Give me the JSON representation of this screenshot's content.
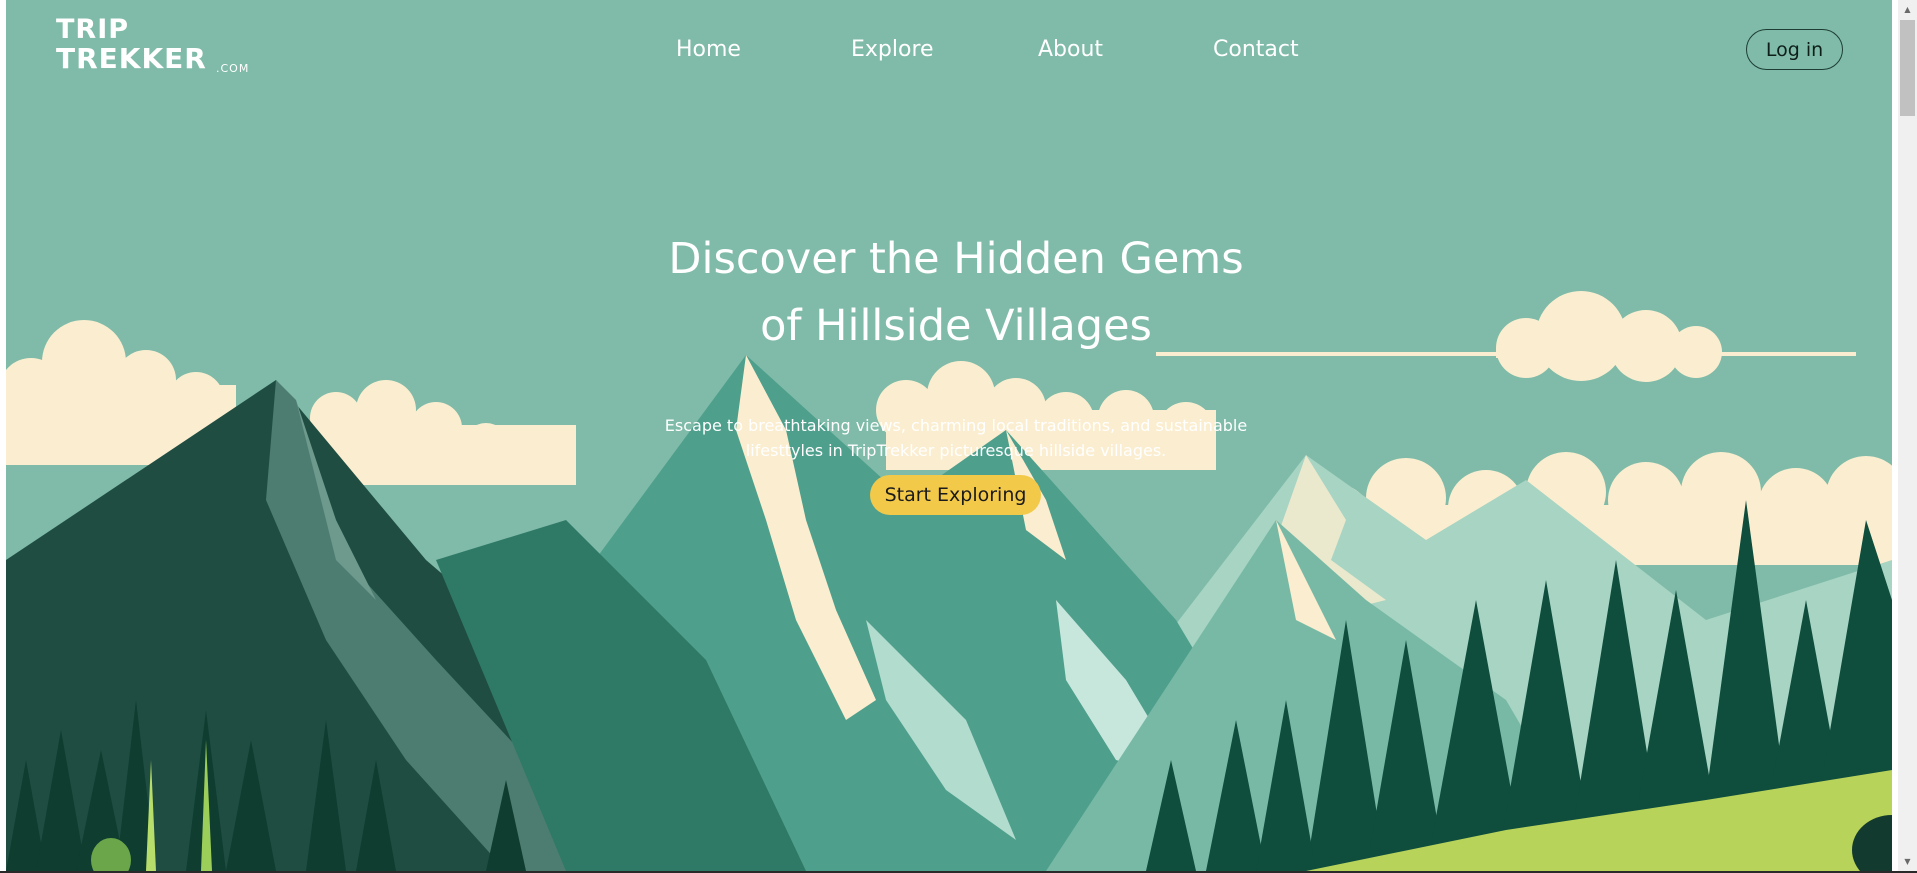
{
  "brand": {
    "logo_line1": "TRIP",
    "logo_line2": "TREKKER",
    "logo_suffix": ".COM"
  },
  "nav": {
    "items": [
      {
        "label": "Home"
      },
      {
        "label": "Explore"
      },
      {
        "label": "About"
      },
      {
        "label": "Contact"
      }
    ],
    "login_label": "Log in"
  },
  "hero": {
    "title_line1": "Discover the Hidden Gems",
    "title_line2": "of Hillside Villages",
    "description": "Escape to breathtaking views, charming local traditions, and sustainable lifesttyles in TripTrekker picturesque hillside villages.",
    "cta_label": "Start Exploring"
  },
  "colors": {
    "sky": "#7fbba8",
    "cloud": "#fbeed0",
    "mountain_dark": "#1b4a3e",
    "mountain_mid": "#3f9682",
    "mountain_light": "#9ccfbe",
    "forest": "#0f4d3d",
    "meadow": "#b8d35a",
    "cta": "#f3c94a",
    "text": "#ffffff"
  },
  "icons": {
    "scroll_up": "triangle-up-icon",
    "scroll_down": "triangle-down-icon"
  }
}
